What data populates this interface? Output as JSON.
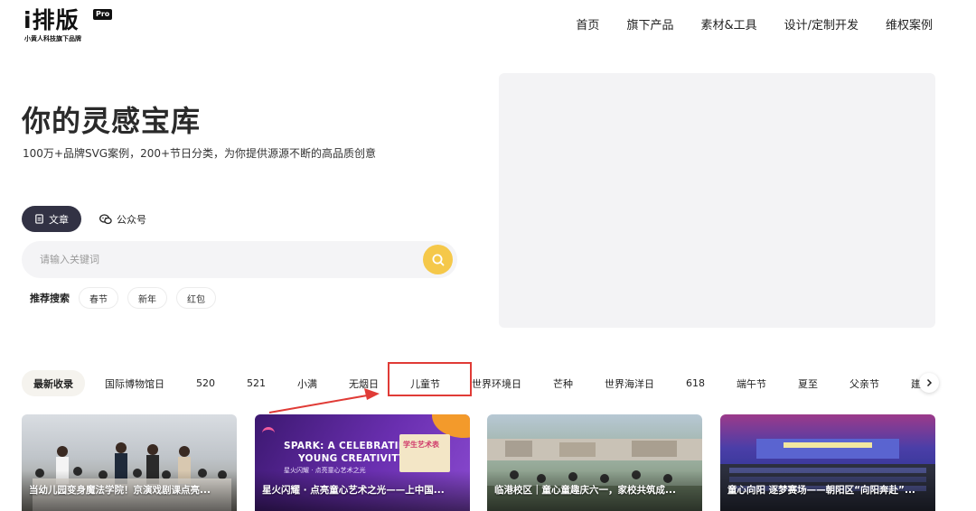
{
  "header": {
    "logo": "i排版",
    "logo_badge": "Pro",
    "logo_sub": "小黄人科技旗下品牌",
    "nav": [
      "首页",
      "旗下产品",
      "素材&工具",
      "设计/定制开发",
      "维权案例"
    ]
  },
  "hero": {
    "title": "你的灵感宝库",
    "subtitle": "100万+品牌SVG案例，200+节日分类，为你提供源源不断的高品质创意"
  },
  "type_tabs": [
    {
      "label": "文章",
      "icon": "document-icon",
      "active": true
    },
    {
      "label": "公众号",
      "icon": "wechat-icon",
      "active": false
    }
  ],
  "search": {
    "placeholder": "请输入关键词",
    "button_icon": "search-icon",
    "accent": "#f5c84a"
  },
  "recommend": {
    "label": "推荐搜索",
    "tags": [
      "春节",
      "新年",
      "红包"
    ]
  },
  "categories": {
    "items": [
      "最新收录",
      "国际博物馆日",
      "520",
      "521",
      "小满",
      "无烟日",
      "儿童节",
      "世界环境日",
      "芒种",
      "世界海洋日",
      "618",
      "端午节",
      "夏至",
      "父亲节",
      "建党"
    ],
    "active": "最新收录",
    "highlighted": "儿童节",
    "next_icon": "chevron-right-icon"
  },
  "cards": [
    {
      "title": "当幼儿园变身魔法学院！京演戏剧课点亮..."
    },
    {
      "title": "星火闪耀 · 点亮童心艺术之光——上中国...",
      "headline_1": "SPARK: A CELEBRATING OF",
      "headline_2": "YOUNG CREATIVITY",
      "board_text": "学生艺术表",
      "cn_line": "星火闪耀 · 点亮童心艺术之光"
    },
    {
      "title": "临港校区｜童心童趣庆六一，家校共筑成..."
    },
    {
      "title": "童心向阳 逐梦赛场——朝阳区“向阳奔赴”..."
    }
  ],
  "colors": {
    "dark_tab": "#323244",
    "highlight_red": "#e03b36"
  }
}
